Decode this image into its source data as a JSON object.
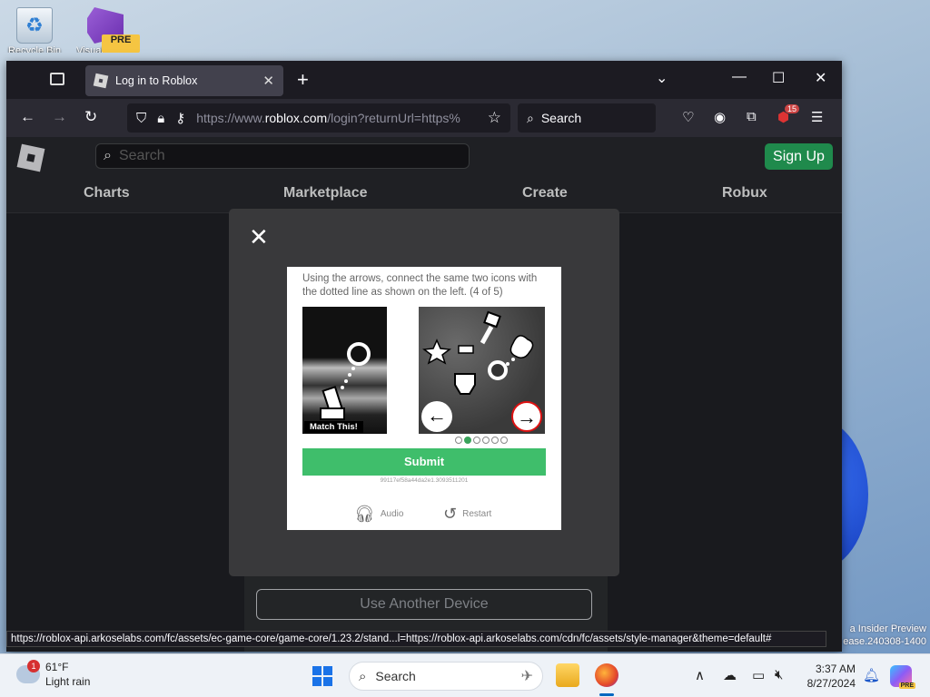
{
  "desktop": {
    "icons": [
      {
        "label": "Recycle Bin"
      },
      {
        "label": "Visual Studio",
        "badge": "PRE"
      }
    ],
    "watermark_line1": "a Insider Preview",
    "watermark_line2": "ease.240308-1400"
  },
  "browser": {
    "tab_title": "Log in to Roblox",
    "tab_close": "✕",
    "new_tab": "+",
    "url_prefix": "https://www.",
    "url_domain": "roblox.com",
    "url_rest": "/login?returnUrl=https%",
    "search_label": "Search",
    "extension_badge": "15",
    "status_url": "https://roblox-api.arkoselabs.com/fc/assets/ec-game-core/game-core/1.23.2/stand...l=https://roblox-api.arkoselabs.com/cdn/fc/assets/style-manager&theme=default#"
  },
  "roblox": {
    "search_placeholder": "Search",
    "signup_label": "Sign Up",
    "nav": [
      "Charts",
      "Marketplace",
      "Create",
      "Robux"
    ],
    "another_device_label": "Use Another Device"
  },
  "captcha": {
    "close": "✕",
    "instruction": "Using the arrows, connect the same two icons with the dotted line as shown on the left. (4 of 5)",
    "match_label": "Match This!",
    "left_arrow": "←",
    "right_arrow": "→",
    "dots_total": 6,
    "dots_active_index": 1,
    "submit_label": "Submit",
    "session_id": "99117ef58a44da2e1.3093511201",
    "audio_label": "Audio",
    "restart_label": "Restart"
  },
  "taskbar": {
    "weather_badge": "1",
    "temperature": "61°F",
    "condition": "Light rain",
    "search_label": "Search",
    "time": "3:37 AM",
    "date": "8/27/2024",
    "copilot_badge": "PRE"
  }
}
